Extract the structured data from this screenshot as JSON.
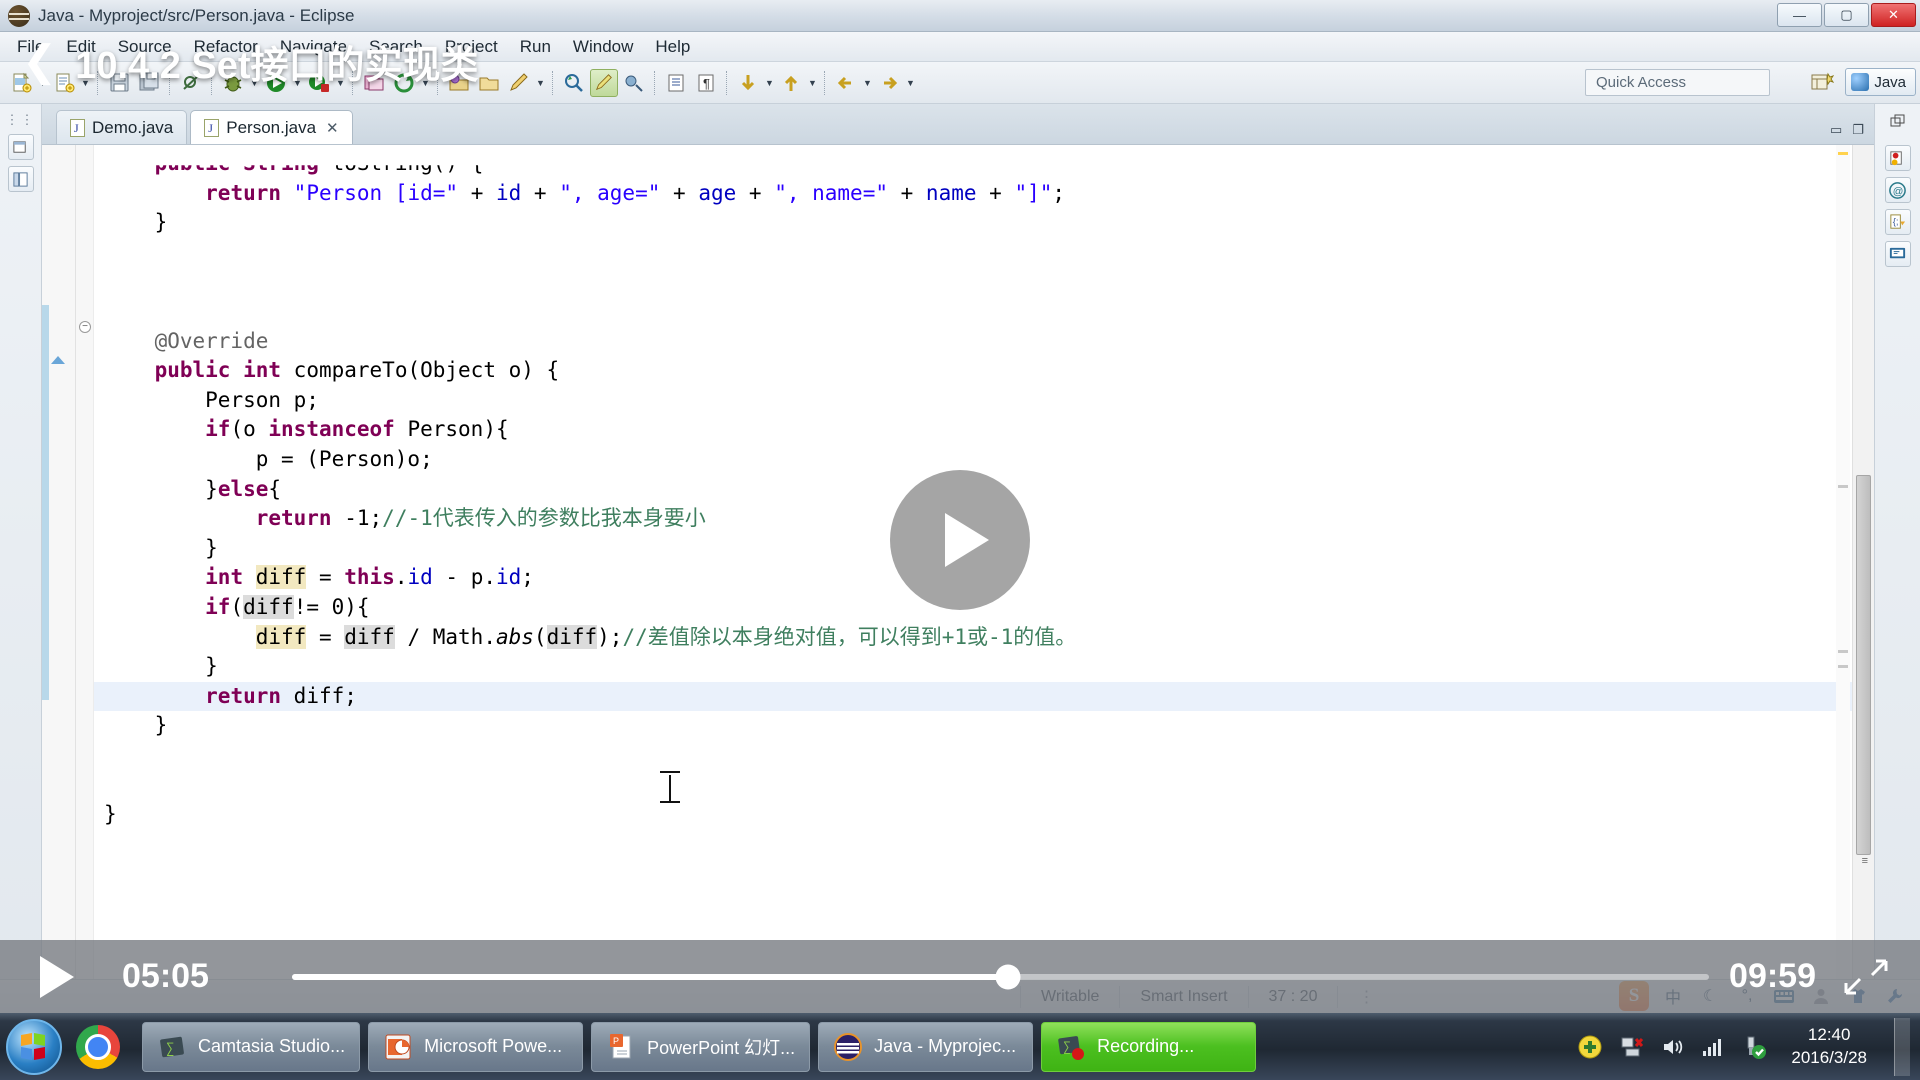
{
  "window": {
    "title": "Java - Myproject/src/Person.java - Eclipse",
    "app_icon": "eclipse-icon",
    "minimize": "—",
    "maximize": "▢",
    "close": "✕"
  },
  "menubar": {
    "items": [
      "File",
      "Edit",
      "Source",
      "Refactor",
      "Navigate",
      "Search",
      "Project",
      "Run",
      "Window",
      "Help"
    ]
  },
  "toolbar": {
    "quick_access_placeholder": "Quick Access",
    "perspective_button": "open-perspective-icon",
    "perspective_label": "Java"
  },
  "tabs": [
    {
      "label": "Demo.java",
      "active": false,
      "closable": false
    },
    {
      "label": "Person.java",
      "active": true,
      "closable": true,
      "close_glyph": "✕"
    }
  ],
  "editor": {
    "file": "Person.java",
    "cursor": "37 : 20",
    "lines": [
      {
        "indent": 1,
        "tokens": [
          {
            "t": "public ",
            "c": "kw"
          },
          {
            "t": "String ",
            "c": "kw"
          },
          {
            "t": "toString",
            "c": "plain"
          },
          {
            "t": "() {",
            "c": "plain"
          }
        ],
        "clipped": true
      },
      {
        "indent": 2,
        "tokens": [
          {
            "t": "return ",
            "c": "kw"
          },
          {
            "t": "\"Person [id=\"",
            "c": "str"
          },
          {
            "t": " + ",
            "c": "plain"
          },
          {
            "t": "id",
            "c": "fld"
          },
          {
            "t": " + ",
            "c": "plain"
          },
          {
            "t": "\", age=\"",
            "c": "str"
          },
          {
            "t": " + ",
            "c": "plain"
          },
          {
            "t": "age",
            "c": "fld"
          },
          {
            "t": " + ",
            "c": "plain"
          },
          {
            "t": "\", name=\"",
            "c": "str"
          },
          {
            "t": " + ",
            "c": "plain"
          },
          {
            "t": "name",
            "c": "fld"
          },
          {
            "t": " + ",
            "c": "plain"
          },
          {
            "t": "\"]\"",
            "c": "str"
          },
          {
            "t": ";",
            "c": "plain"
          }
        ]
      },
      {
        "indent": 1,
        "tokens": [
          {
            "t": "}",
            "c": "plain"
          }
        ]
      },
      {
        "indent": 0,
        "tokens": []
      },
      {
        "indent": 0,
        "tokens": []
      },
      {
        "indent": 0,
        "tokens": []
      },
      {
        "indent": 1,
        "tokens": [
          {
            "t": "@Override",
            "c": "ann"
          }
        ]
      },
      {
        "indent": 1,
        "tokens": [
          {
            "t": "public ",
            "c": "kw"
          },
          {
            "t": "int ",
            "c": "kw"
          },
          {
            "t": "compareTo",
            "c": "plain"
          },
          {
            "t": "(Object o) {",
            "c": "plain"
          }
        ]
      },
      {
        "indent": 2,
        "tokens": [
          {
            "t": "Person p;",
            "c": "plain"
          }
        ]
      },
      {
        "indent": 2,
        "tokens": [
          {
            "t": "if",
            "c": "kw"
          },
          {
            "t": "(o ",
            "c": "plain"
          },
          {
            "t": "instanceof ",
            "c": "kw"
          },
          {
            "t": "Person){",
            "c": "plain"
          }
        ]
      },
      {
        "indent": 3,
        "tokens": [
          {
            "t": "p = (Person)o;",
            "c": "plain"
          }
        ]
      },
      {
        "indent": 2,
        "tokens": [
          {
            "t": "}",
            "c": "plain"
          },
          {
            "t": "else",
            "c": "kw"
          },
          {
            "t": "{",
            "c": "plain"
          }
        ]
      },
      {
        "indent": 3,
        "tokens": [
          {
            "t": "return ",
            "c": "kw"
          },
          {
            "t": "-1;",
            "c": "plain"
          },
          {
            "t": "//-1代表传入的参数比我本身要小",
            "c": "cmt"
          }
        ]
      },
      {
        "indent": 2,
        "tokens": [
          {
            "t": "}",
            "c": "plain"
          }
        ]
      },
      {
        "indent": 2,
        "tokens": [
          {
            "t": "int ",
            "c": "kw"
          },
          {
            "t": "diff",
            "c": "occ"
          },
          {
            "t": " = ",
            "c": "plain"
          },
          {
            "t": "this",
            "c": "kw"
          },
          {
            "t": ".",
            "c": "plain"
          },
          {
            "t": "id",
            "c": "fld"
          },
          {
            "t": " - p.",
            "c": "plain"
          },
          {
            "t": "id",
            "c": "fld"
          },
          {
            "t": ";",
            "c": "plain"
          }
        ]
      },
      {
        "indent": 2,
        "tokens": [
          {
            "t": "if",
            "c": "kw"
          },
          {
            "t": "(",
            "c": "plain"
          },
          {
            "t": "diff",
            "c": "occ2"
          },
          {
            "t": "!= 0){",
            "c": "plain"
          }
        ]
      },
      {
        "indent": 3,
        "tokens": [
          {
            "t": "diff",
            "c": "occ"
          },
          {
            "t": " = ",
            "c": "plain"
          },
          {
            "t": "diff",
            "c": "occ2"
          },
          {
            "t": " / Math.",
            "c": "plain"
          },
          {
            "t": "abs",
            "c": "stat"
          },
          {
            "t": "(",
            "c": "plain"
          },
          {
            "t": "diff",
            "c": "occ2"
          },
          {
            "t": ");",
            "c": "plain"
          },
          {
            "t": "//差值除以本身绝对值，可以得到+1或-1的值。",
            "c": "cmt"
          }
        ]
      },
      {
        "indent": 2,
        "tokens": [
          {
            "t": "}",
            "c": "plain"
          }
        ]
      },
      {
        "indent": 2,
        "tokens": [
          {
            "t": "return ",
            "c": "kw"
          },
          {
            "t": "diff",
            "c": "plain"
          },
          {
            "t": ";",
            "c": "plain"
          }
        ],
        "highlight": true
      },
      {
        "indent": 1,
        "tokens": [
          {
            "t": "}",
            "c": "plain"
          }
        ]
      },
      {
        "indent": 0,
        "tokens": []
      },
      {
        "indent": 0,
        "tokens": []
      },
      {
        "indent": 0,
        "tokens": [
          {
            "t": "}",
            "c": "plain"
          }
        ]
      }
    ]
  },
  "statusbar": {
    "writable": "Writable",
    "insert_mode": "Smart Insert",
    "position": "37 : 20",
    "dots": "⋮"
  },
  "video": {
    "back_glyph": "❮",
    "title": "10.4.2 Set接口的实现类",
    "play_glyph": "▶",
    "current_time": "05:05",
    "total_time": "09:59",
    "progress_percent": 50.5,
    "fullscreen_icon": "expand-icon"
  },
  "taskbar": {
    "start_label": "start-orb",
    "pinned": [
      {
        "name": "chrome-icon"
      }
    ],
    "items": [
      {
        "label": "Camtasia Studio...",
        "icon": "camtasia-icon",
        "active": false
      },
      {
        "label": "Microsoft Powe...",
        "icon": "powerpoint-icon",
        "active": false
      },
      {
        "label": "PowerPoint 幻灯...",
        "icon": "powerpoint-doc-icon",
        "active": false
      },
      {
        "label": "Java - Myprojec...",
        "icon": "eclipse-icon",
        "active": false
      },
      {
        "label": "Recording...",
        "icon": "recording-icon",
        "active": true
      }
    ],
    "tray": [
      {
        "name": "update-icon",
        "glyph": "✚"
      },
      {
        "name": "network-alert-icon",
        "glyph": "🖧"
      },
      {
        "name": "volume-icon",
        "glyph": "🔊"
      },
      {
        "name": "signal-icon",
        "glyph": "▂▄▆"
      },
      {
        "name": "usb-safe-remove-icon",
        "glyph": "✔"
      }
    ],
    "clock_time": "12:40",
    "clock_date": "2016/3/28"
  },
  "ime_tray": {
    "logo": "S",
    "items": [
      {
        "name": "chinese-mode-icon",
        "glyph": "中"
      },
      {
        "name": "moon-icon",
        "glyph": "☾"
      },
      {
        "name": "punctuation-icon",
        "glyph": "°,"
      },
      {
        "name": "keyboard-icon",
        "glyph": "⌨"
      },
      {
        "name": "user-icon",
        "glyph": "👤"
      },
      {
        "name": "skin-icon",
        "glyph": "👕"
      },
      {
        "name": "tools-icon",
        "glyph": "🔧"
      }
    ]
  }
}
